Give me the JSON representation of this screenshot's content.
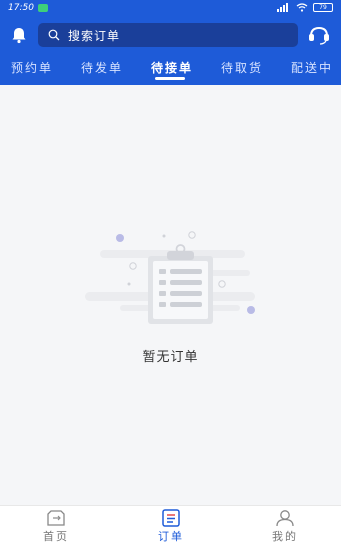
{
  "status_bar": {
    "time": "17:50",
    "battery": "79"
  },
  "search": {
    "placeholder": "搜索订单"
  },
  "tabs": [
    {
      "label": "预约单",
      "active": false
    },
    {
      "label": "待发单",
      "active": false
    },
    {
      "label": "待接单",
      "active": true
    },
    {
      "label": "待取货",
      "active": false
    },
    {
      "label": "配送中",
      "active": false
    }
  ],
  "empty_state": {
    "message": "暂无订单"
  },
  "bottom_nav": [
    {
      "label": "首页",
      "icon": "home-icon",
      "active": false
    },
    {
      "label": "订单",
      "icon": "orders-icon",
      "active": true
    },
    {
      "label": "我的",
      "icon": "profile-icon",
      "active": false
    }
  ],
  "colors": {
    "primary": "#1e5bd8",
    "search_bg": "#1a3f9a",
    "background": "#f5f6f8"
  }
}
